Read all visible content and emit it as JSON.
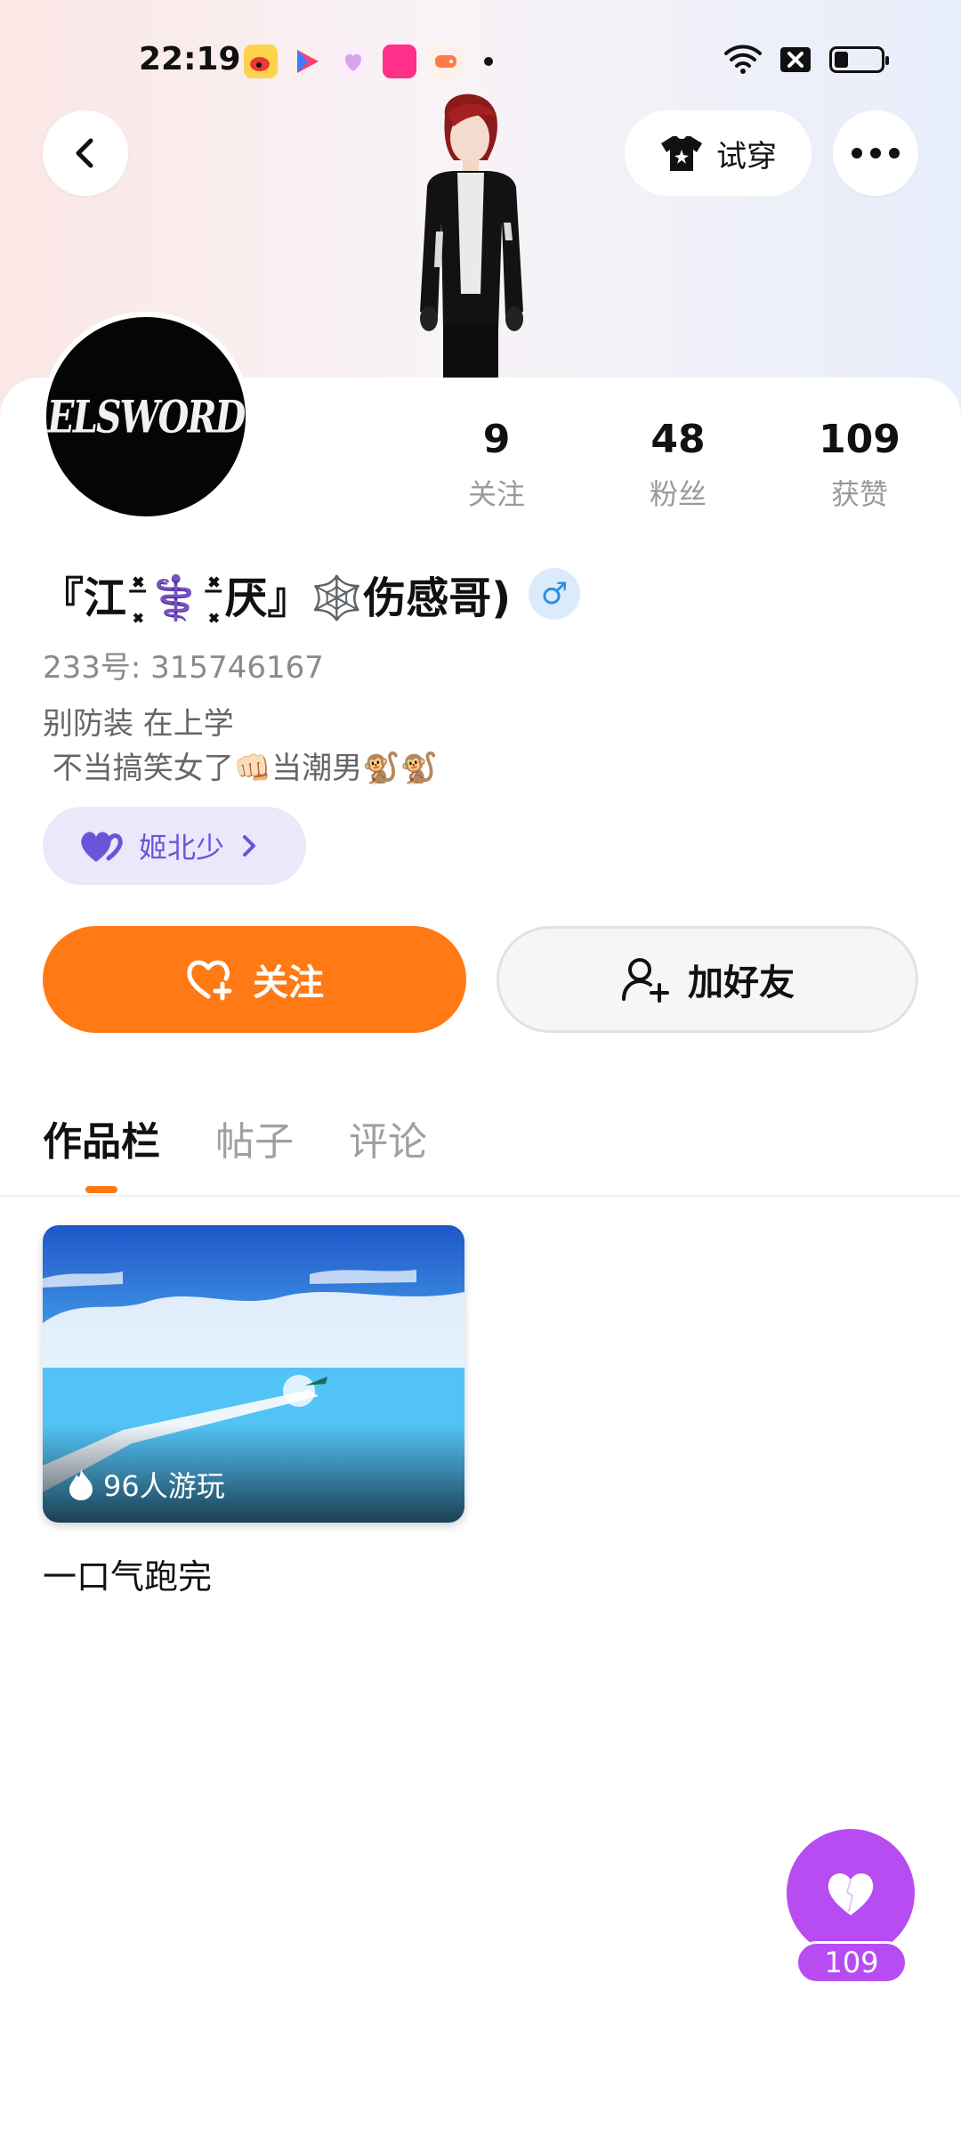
{
  "status_bar": {
    "time": "22:19",
    "notification_icons": [
      "weibo-icon",
      "video-app-icon",
      "chat-app-icon",
      "shop-app-icon",
      "game-app-icon"
    ],
    "system_icons": [
      "wifi-icon",
      "no-sim-icon",
      "battery-icon"
    ],
    "battery_level": 0.3
  },
  "header": {
    "try_on_label": "试穿"
  },
  "profile": {
    "avatar_text": "ELSWORD",
    "stats": [
      {
        "value": "9",
        "label": "关注"
      },
      {
        "value": "48",
        "label": "粉丝"
      },
      {
        "value": "109",
        "label": "获赞"
      }
    ],
    "nickname": "『江⁻͓̽‍⚕️‍⁻͓̽厌』🕸️伤感哥)",
    "gender_symbol": "♂",
    "uid_label": "233号:",
    "uid_value": "315746167",
    "bio_lines": [
      "别防装 在上学",
      " 不当搞笑女了👊🏻当潮男🐒🐒"
    ],
    "tag_label": "姬北少"
  },
  "actions": {
    "follow_label": "关注",
    "add_friend_label": "加好友"
  },
  "tabs": [
    "作品栏",
    "帖子",
    "评论"
  ],
  "works": [
    {
      "plays": "96人游玩",
      "title": "一口气跑完"
    }
  ],
  "likes": {
    "count": "109"
  },
  "colors": {
    "accent_orange": "#ff7a14",
    "like_purple": "#b64cf2",
    "tag_purple": "#6a55d8",
    "tag_bg": "#ece8fb",
    "gender_blue": "#2d8ee6"
  }
}
